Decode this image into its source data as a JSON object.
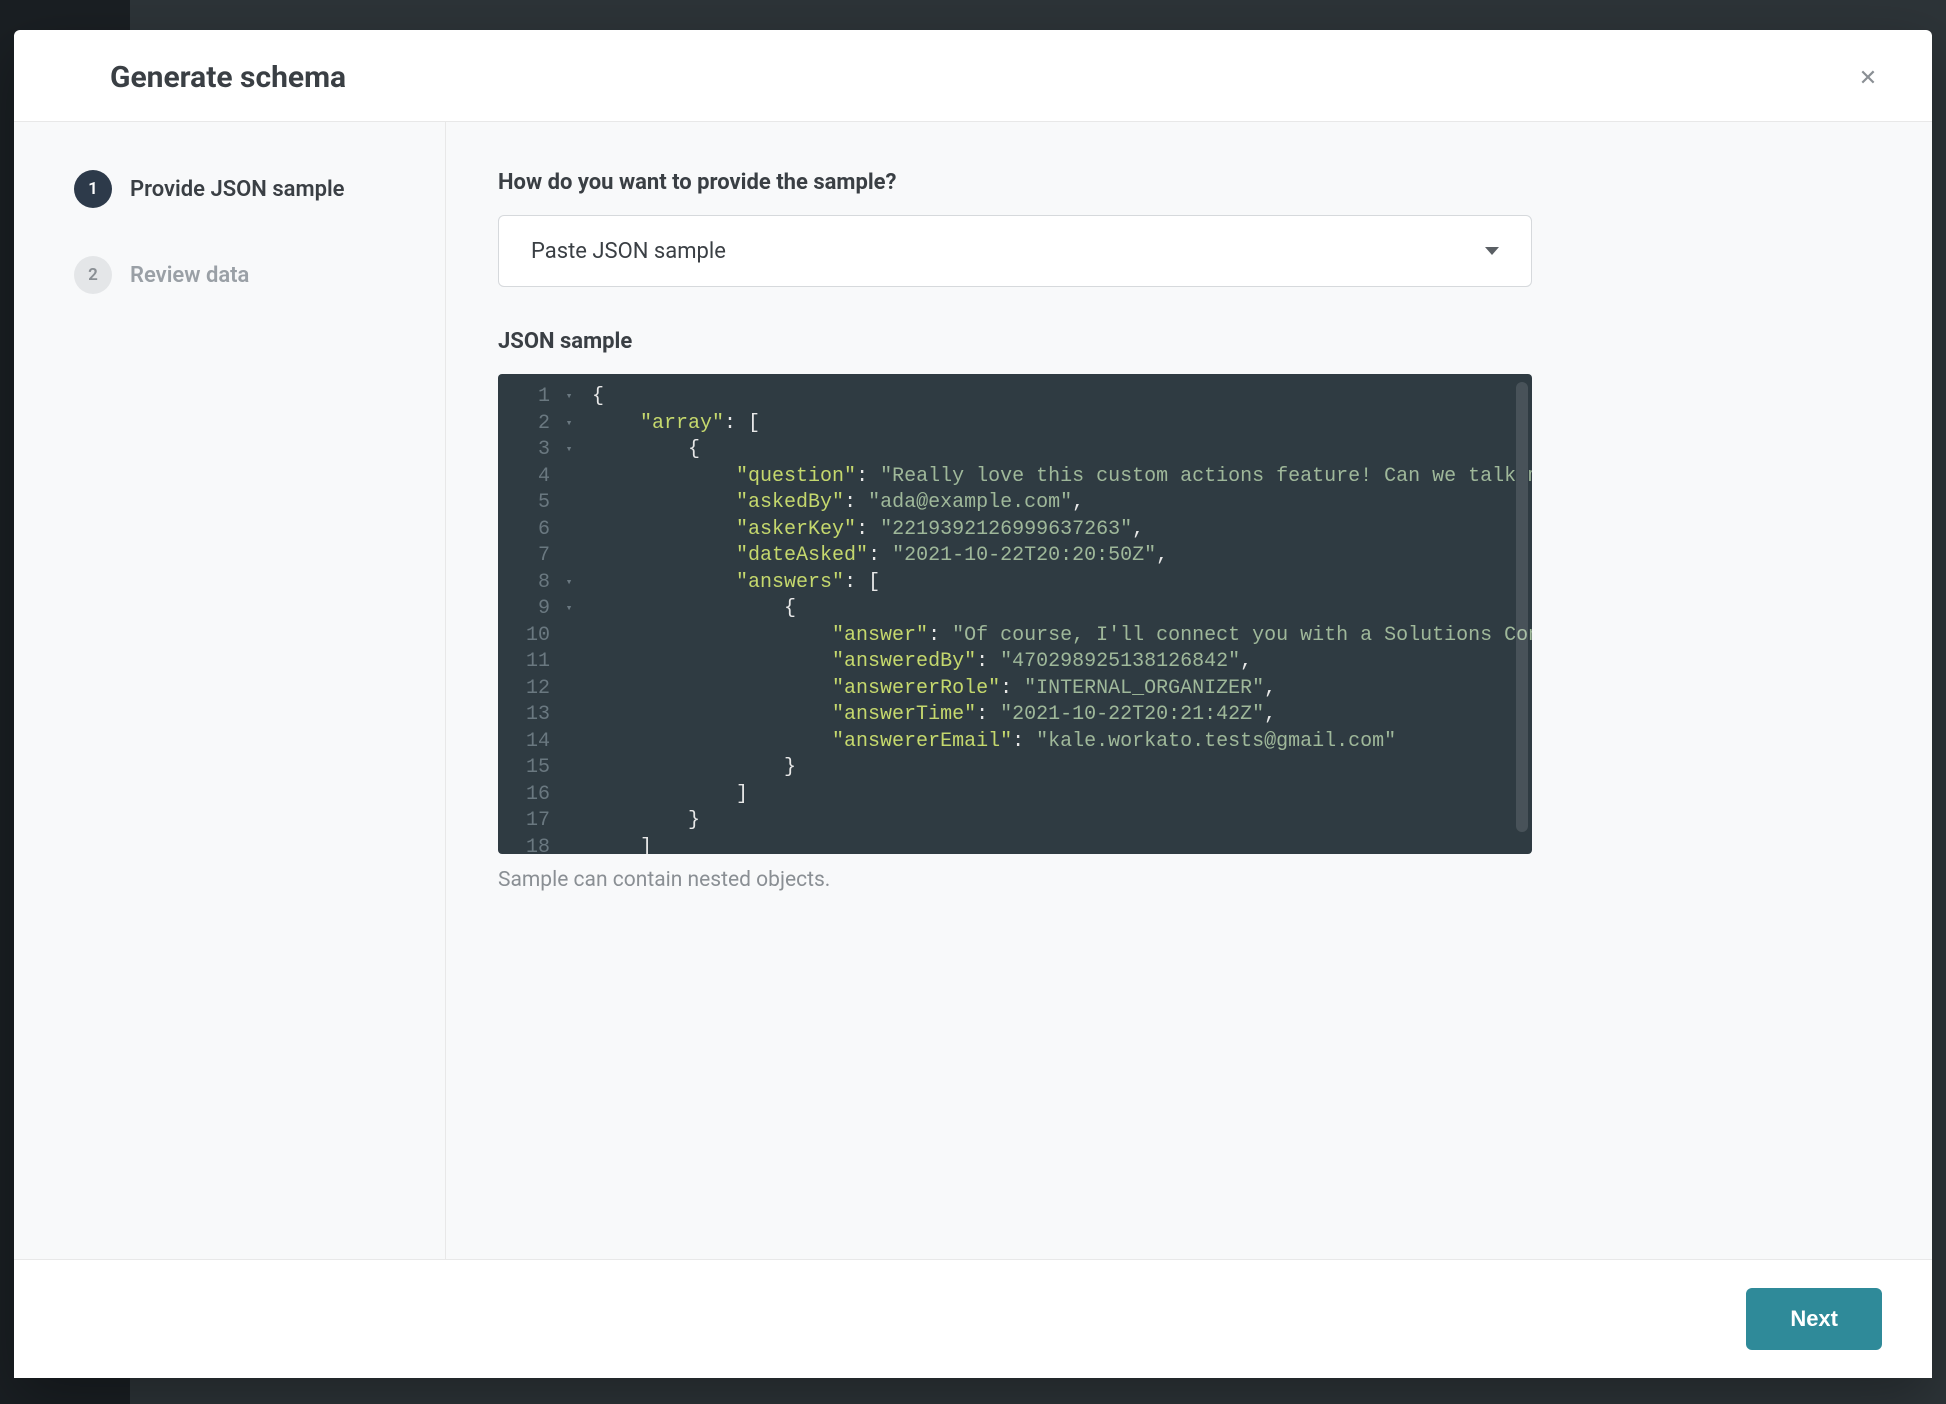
{
  "modal": {
    "title": "Generate schema"
  },
  "sidebar": {
    "steps": [
      {
        "num": "1",
        "label": "Provide JSON sample",
        "active": true
      },
      {
        "num": "2",
        "label": "Review data",
        "active": false
      }
    ]
  },
  "main": {
    "prompt_label": "How do you want to provide the sample?",
    "select_value": "Paste JSON sample",
    "json_label": "JSON sample",
    "hint": "Sample can contain nested objects."
  },
  "code": {
    "lines": [
      {
        "n": 1,
        "fold": "▾",
        "indent": 0,
        "tokens": [
          [
            "punc",
            "{"
          ]
        ]
      },
      {
        "n": 2,
        "fold": "▾",
        "indent": 4,
        "tokens": [
          [
            "key",
            "\"array\""
          ],
          [
            "punc",
            ": ["
          ]
        ]
      },
      {
        "n": 3,
        "fold": "▾",
        "indent": 8,
        "tokens": [
          [
            "punc",
            "{"
          ]
        ]
      },
      {
        "n": 4,
        "fold": "",
        "indent": 12,
        "tokens": [
          [
            "key",
            "\"question\""
          ],
          [
            "punc",
            ": "
          ],
          [
            "str",
            "\"Really love this custom actions feature! Can we talk more about it?\""
          ],
          [
            "punc",
            ","
          ]
        ]
      },
      {
        "n": 5,
        "fold": "",
        "indent": 12,
        "tokens": [
          [
            "key",
            "\"askedBy\""
          ],
          [
            "punc",
            ": "
          ],
          [
            "str",
            "\"ada@example.com\""
          ],
          [
            "punc",
            ","
          ]
        ]
      },
      {
        "n": 6,
        "fold": "",
        "indent": 12,
        "tokens": [
          [
            "key",
            "\"askerKey\""
          ],
          [
            "punc",
            ": "
          ],
          [
            "str",
            "\"2219392126999637263\""
          ],
          [
            "punc",
            ","
          ]
        ]
      },
      {
        "n": 7,
        "fold": "",
        "indent": 12,
        "tokens": [
          [
            "key",
            "\"dateAsked\""
          ],
          [
            "punc",
            ": "
          ],
          [
            "str",
            "\"2021-10-22T20:20:50Z\""
          ],
          [
            "punc",
            ","
          ]
        ]
      },
      {
        "n": 8,
        "fold": "▾",
        "indent": 12,
        "tokens": [
          [
            "key",
            "\"answers\""
          ],
          [
            "punc",
            ": ["
          ]
        ]
      },
      {
        "n": 9,
        "fold": "▾",
        "indent": 16,
        "tokens": [
          [
            "punc",
            "{"
          ]
        ]
      },
      {
        "n": 10,
        "fold": "",
        "indent": 20,
        "tokens": [
          [
            "key",
            "\"answer\""
          ],
          [
            "punc",
            ": "
          ],
          [
            "str",
            "\"Of course, I'll connect you with a Solutions Consultant after the webinar\""
          ],
          [
            "punc",
            ","
          ]
        ]
      },
      {
        "n": 11,
        "fold": "",
        "indent": 20,
        "tokens": [
          [
            "key",
            "\"answeredBy\""
          ],
          [
            "punc",
            ": "
          ],
          [
            "str",
            "\"470298925138126842\""
          ],
          [
            "punc",
            ","
          ]
        ]
      },
      {
        "n": 12,
        "fold": "",
        "indent": 20,
        "tokens": [
          [
            "key",
            "\"answererRole\""
          ],
          [
            "punc",
            ": "
          ],
          [
            "str",
            "\"INTERNAL_ORGANIZER\""
          ],
          [
            "punc",
            ","
          ]
        ]
      },
      {
        "n": 13,
        "fold": "",
        "indent": 20,
        "tokens": [
          [
            "key",
            "\"answerTime\""
          ],
          [
            "punc",
            ": "
          ],
          [
            "str",
            "\"2021-10-22T20:21:42Z\""
          ],
          [
            "punc",
            ","
          ]
        ]
      },
      {
        "n": 14,
        "fold": "",
        "indent": 20,
        "tokens": [
          [
            "key",
            "\"answererEmail\""
          ],
          [
            "punc",
            ": "
          ],
          [
            "str",
            "\"kale.workato.tests@gmail.com\""
          ]
        ]
      },
      {
        "n": 15,
        "fold": "",
        "indent": 16,
        "tokens": [
          [
            "punc",
            "}"
          ]
        ]
      },
      {
        "n": 16,
        "fold": "",
        "indent": 12,
        "tokens": [
          [
            "punc",
            "]"
          ]
        ]
      },
      {
        "n": 17,
        "fold": "",
        "indent": 8,
        "tokens": [
          [
            "punc",
            "}"
          ]
        ]
      },
      {
        "n": 18,
        "fold": "",
        "indent": 4,
        "tokens": [
          [
            "punc",
            "]"
          ]
        ]
      }
    ]
  },
  "footer": {
    "next_label": "Next"
  }
}
